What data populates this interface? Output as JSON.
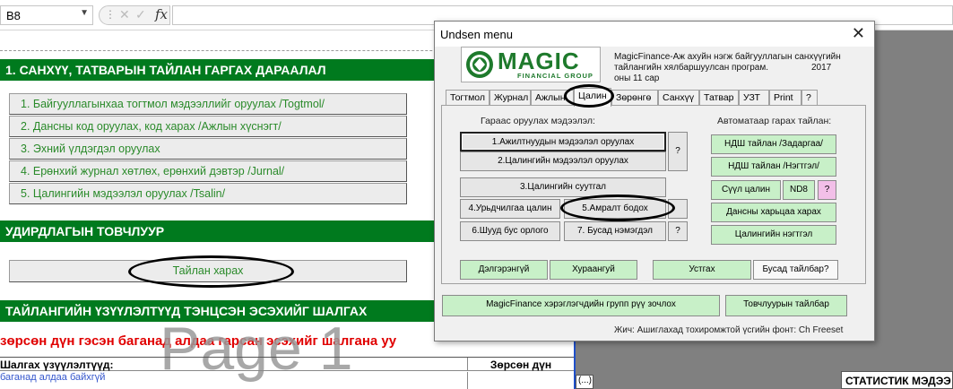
{
  "formula_bar": {
    "name_box": "B8",
    "fx": "fx",
    "formula": ""
  },
  "sheet": {
    "header1": "1. САНХҮҮ, ТАТВАРЫН ТАЙЛАН ГАРГАХ ДАРААЛАЛ",
    "steps": [
      "1. Байгууллагынхаа тогтмол мэдээллийг оруулах /Togtmol/",
      "2. Дансны код оруулах, код харах /Ажлын хүснэгт/",
      "3. Эхний үлдэгдэл оруулах",
      "4. Ерөнхий журнал хөтлөх, ерөнхий дэвтэр /Jurnal/",
      "5. Цалингийн мэдээлэл оруулах /Tsalin/"
    ],
    "header2": "УДИРДЛАГЫН ТОВЧЛУУР",
    "report_button": "Тайлан харах",
    "header3": "ТАЙЛАНГИЙН ҮЗҮҮЛЭЛТҮҮД ТЭНЦСЭН ЭСЭХИЙГ ШАЛГАХ",
    "red_note": "зөрсөн дүн гэсэн баганад алдаа гарсан эсэхийг шалгана уу",
    "watermark": "Page 1",
    "table_col1": "Шалгах үзүүлэлтүүд:",
    "table_col2": "Зөрсөн дүн",
    "table_row1": "баганад алдаа байхгүй",
    "small_cell": "(...)",
    "stat_cell": "СТАТИСТИК МЭДЭЭ"
  },
  "dialog": {
    "title": "Undsen menu",
    "close": "✕",
    "logo_word": "MAGIC",
    "logo_sub": "FINANCIAL GROUP",
    "info_line1": "MagicFinance-Аж ахуйн нэгж байгууллагын санхүүгийн",
    "info_line2": "тайлангийн хялбаршуулсан програм.",
    "info_year": "2017",
    "info_line3": "оны 11 сар",
    "tabs": [
      "Тогтмол",
      "Журнал",
      "Ажлын",
      "Цалин",
      "Зөрөнгө",
      "Санхүү",
      "Татвар",
      "УЗТ",
      "Print",
      "?"
    ],
    "active_tab": "Цалин",
    "left_label": "Гараас оруулах мэдээлэл:",
    "right_label": "Автоматаар гарах тайлан:",
    "btn1": "1.Ажилтнуудын мэдээлэл оруулах",
    "btn2": "2.Цалингийн мэдээлэл оруулах",
    "btn3": "3.Цалингийн суутгал",
    "btn4": "4.Урьдчилгаа цалин",
    "btn5": "5.Амралт бодох",
    "btn6": "6.Шууд бус орлого",
    "btn7": "7. Бусад нэмэгдэл",
    "q": "?",
    "r1": "НДШ тайлан /Задаргаа/",
    "r2": "НДШ тайлан /Нэгтгэл/",
    "r3": "Сүүл цалин",
    "r3b": "ND8",
    "r3c": "?",
    "r4": "Дансны харьцаа харах",
    "r5": "Цалингийн нэгтгэл",
    "b_debit": "Дэлгэрэнгүй",
    "b_short": "Хураангуй",
    "b_clear": "Устгах",
    "b_other": "Бусад тайлбар?",
    "b_group": "MagicFinance хэрэглэгчдийн групп рүү зочлох",
    "b_help": "Товчлуурын тайлбар",
    "note": "Жич: Ашиглахад тохиромжтой үсгийн фонт: Ch Freeset"
  }
}
